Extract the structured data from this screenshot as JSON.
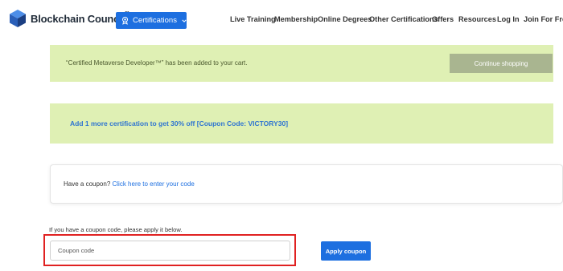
{
  "header": {
    "logo_text": "Blockchain Council",
    "logo_tm": "™",
    "certifications_button": "Certifications",
    "nav": [
      "Live Training",
      "Membership",
      "Online Degrees",
      "Other Certifications",
      "Offers",
      "Resources",
      "Log In",
      "Join For Free"
    ]
  },
  "cart_notice": {
    "message": "“Certified Metaverse Developer™” has been added to your cart.",
    "continue_label": "Continue shopping"
  },
  "promo": {
    "message": "Add 1 more certification to get 30% off [Coupon Code: VICTORY30]"
  },
  "coupon_toggle": {
    "prefix": "Have a coupon?",
    "link": "Click here to enter your code"
  },
  "coupon_form": {
    "hint": "If you have a coupon code, please apply it below.",
    "placeholder": "Coupon code",
    "value": "",
    "apply_label": "Apply coupon"
  },
  "colors": {
    "brand_blue": "#1d6fe0",
    "banner_green": "#dff0b4",
    "highlight_red": "#e02121"
  },
  "icons": {
    "logo": "cube-logo-icon",
    "certifications": "award-badge-icon",
    "dropdown": "chevron-down-icon"
  }
}
